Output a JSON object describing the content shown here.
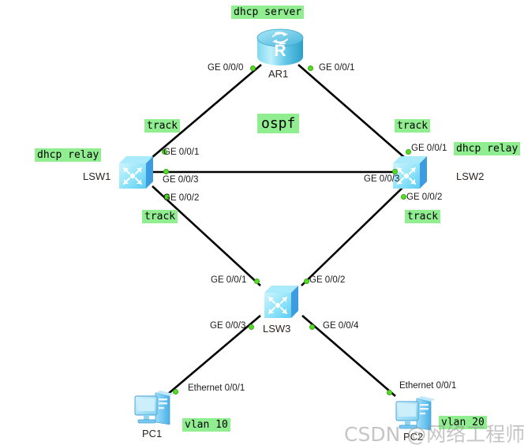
{
  "diagram": {
    "title": "network-topology",
    "accent_green": "#90ee90",
    "dot_color": "#55dd22",
    "link_color": "#000000"
  },
  "nodes": {
    "ar1": {
      "name": "AR1",
      "glyph": "R",
      "type": "router"
    },
    "lsw1": {
      "name": "LSW1",
      "type": "switch"
    },
    "lsw2": {
      "name": "LSW2",
      "type": "switch"
    },
    "lsw3": {
      "name": "LSW3",
      "type": "switch"
    },
    "pc1": {
      "name": "PC1",
      "type": "pc"
    },
    "pc2": {
      "name": "PC2",
      "type": "pc"
    }
  },
  "tags": {
    "dhcp_server": "dhcp server",
    "ospf": "ospf",
    "dhcp_relay_left": "dhcp relay",
    "dhcp_relay_right": "dhcp relay",
    "track_lsw1_top": "track",
    "track_lsw1_bottom": "track",
    "track_lsw2_top": "track",
    "track_lsw2_bottom": "track",
    "vlan_pc1": "vlan 10",
    "vlan_pc2": "vlan 20"
  },
  "ports": {
    "ar1_to_lsw1": "GE 0/0/0",
    "ar1_to_lsw2": "GE 0/0/1",
    "lsw1_to_ar1": "GE 0/0/1",
    "lsw1_to_lsw2": "GE 0/0/3",
    "lsw1_to_lsw3": "GE 0/0/2",
    "lsw2_to_ar1": "GE 0/0/1",
    "lsw2_to_lsw1": "GE 0/0/3",
    "lsw2_to_lsw3": "GE 0/0/2",
    "lsw3_to_lsw1": "GE 0/0/1",
    "lsw3_to_lsw2": "GE 0/0/2",
    "lsw3_to_pc1": "GE 0/0/3",
    "lsw3_to_pc2": "GE 0/0/4",
    "pc1_uplink": "Ethernet 0/0/1",
    "pc2_uplink": "Ethernet 0/0/1"
  },
  "watermark": {
    "text": "CSDN @网络工程师余霆"
  }
}
